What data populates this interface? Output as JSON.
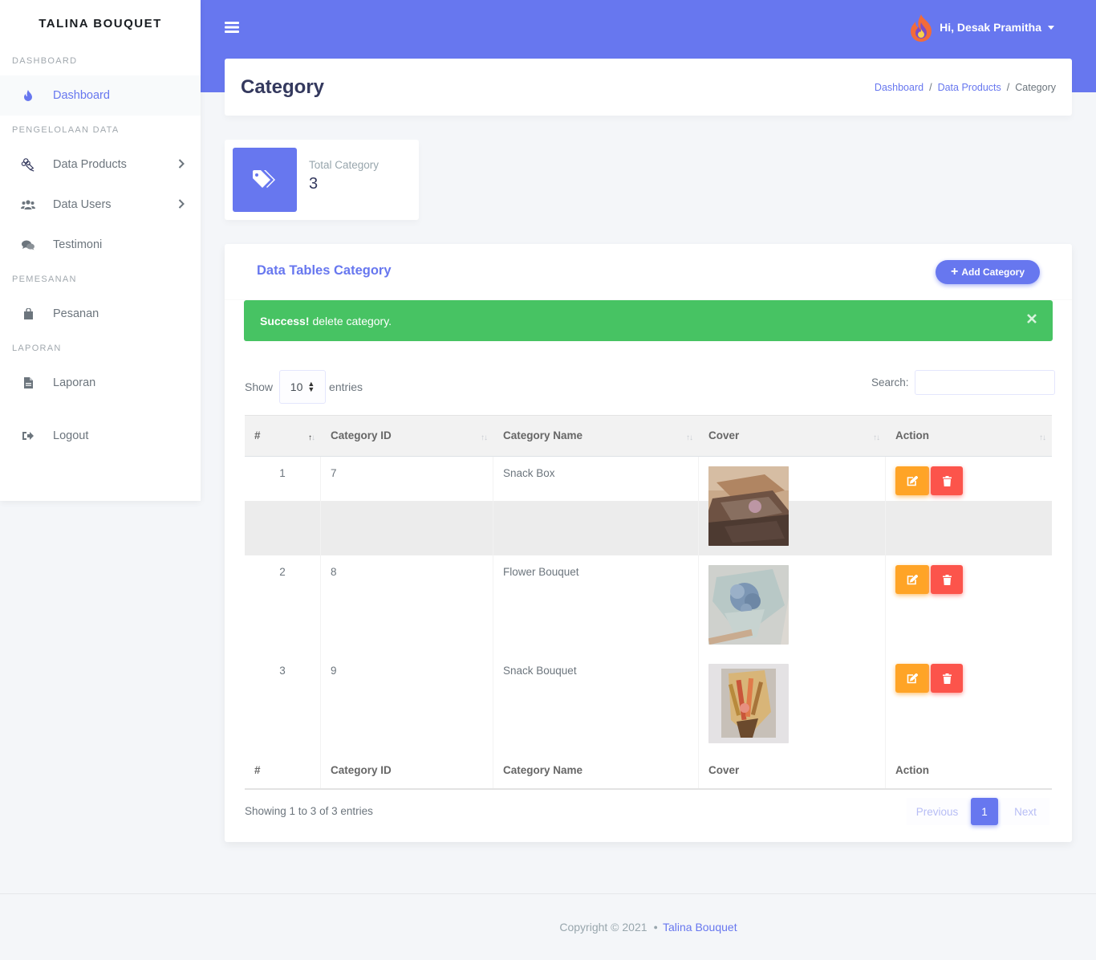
{
  "brand": "TALINA BOUQUET",
  "sidebar": {
    "sections": [
      {
        "header": "DASHBOARD"
      },
      {
        "header": "PENGELOLAAN DATA"
      },
      {
        "header": "PEMESANAN"
      },
      {
        "header": "LAPORAN"
      }
    ],
    "items": [
      {
        "label": "Dashboard",
        "icon": "fire-icon",
        "active": true
      },
      {
        "label": "Data Products",
        "icon": "flower-bouquet-icon",
        "has_submenu": true
      },
      {
        "label": "Data Users",
        "icon": "users-icon",
        "has_submenu": true
      },
      {
        "label": "Testimoni",
        "icon": "comments-icon"
      },
      {
        "label": "Pesanan",
        "icon": "shopping-bag-icon"
      },
      {
        "label": "Laporan",
        "icon": "file-icon"
      },
      {
        "label": "Logout",
        "icon": "sign-out-icon"
      }
    ]
  },
  "topbar": {
    "user_greeting": "Hi, Desak Pramitha",
    "accent": "#6777ef"
  },
  "header": {
    "title": "Category",
    "breadcrumb": [
      "Dashboard",
      "Data Products",
      "Category"
    ],
    "separator": "/"
  },
  "stat": {
    "title": "Total Category",
    "value": "3",
    "icon": "tags-icon"
  },
  "card": {
    "title": "Data Tables Category",
    "add_button": "Add Category",
    "alert": {
      "strong": "Success!",
      "message": "delete category.",
      "color": "#47c363"
    },
    "length": {
      "show": "Show",
      "value": "10",
      "entries": "entries"
    },
    "search_label": "Search:",
    "columns": [
      "#",
      "Category ID",
      "Category Name",
      "Cover",
      "Action"
    ],
    "rows": [
      {
        "no": "1",
        "id": "7",
        "name": "Snack Box",
        "cover": "snack-box-photo"
      },
      {
        "no": "2",
        "id": "8",
        "name": "Flower Bouquet",
        "cover": "flower-bouquet-photo"
      },
      {
        "no": "3",
        "id": "9",
        "name": "Snack Bouquet",
        "cover": "snack-bouquet-photo"
      }
    ],
    "info": "Showing 1 to 3 of 3 entries",
    "pagination": {
      "previous": "Previous",
      "current": "1",
      "next": "Next"
    }
  },
  "footer": {
    "copyright": "Copyright © 2021",
    "brand_link": "Talina Bouquet"
  },
  "colors": {
    "primary": "#6777ef",
    "warning": "#ffa426",
    "danger": "#fc544b",
    "success": "#47c363"
  }
}
